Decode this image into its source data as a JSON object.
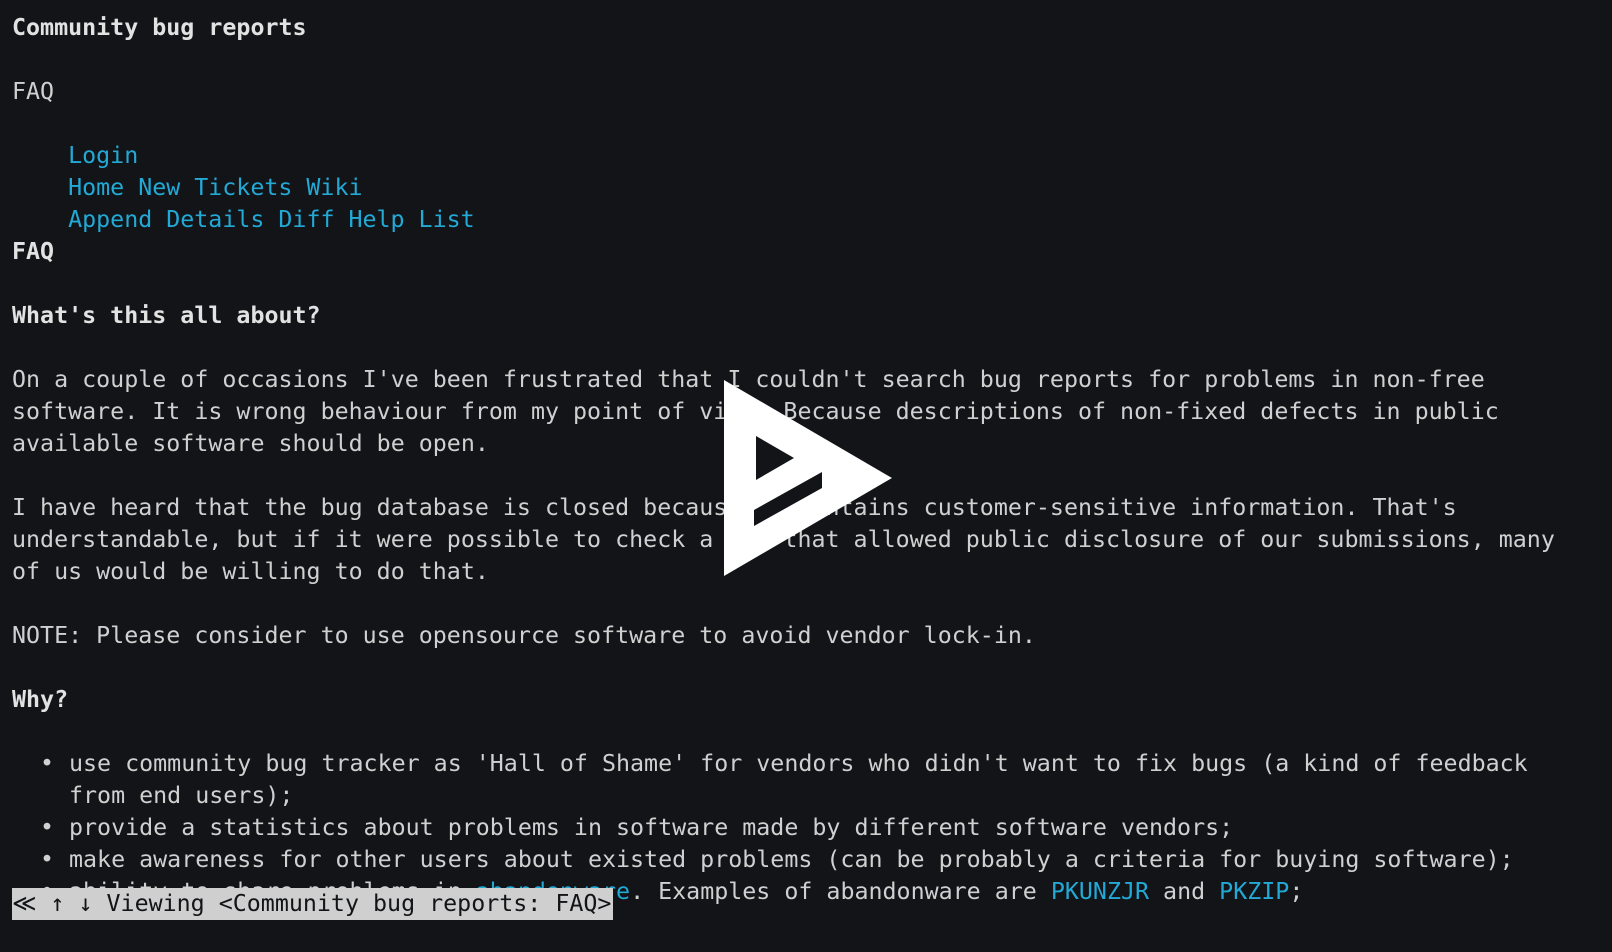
{
  "site": {
    "title": "Community bug reports"
  },
  "nav": {
    "current_page": "FAQ",
    "login": "Login",
    "primary": [
      "Home",
      "New",
      "Tickets",
      "Wiki"
    ],
    "secondary": [
      "Append",
      "Details",
      "Diff",
      "Help",
      "List"
    ]
  },
  "content": {
    "heading": "FAQ",
    "section1_heading": "What's this all about?",
    "para1": "On a couple of occasions I've been frustrated that I couldn't search bug reports for problems in non-free software. It is wrong behaviour from my point of view. Because descriptions of non-fixed defects in public available software should be open.",
    "para2": "I have heard that the bug database is closed because it contains customer-sensitive information. That's understandable, but if it were possible to check a box that allowed public disclosure of our submissions, many of us would be willing to do that.",
    "note": "NOTE: Please consider to use opensource software to avoid vendor lock-in.",
    "section2_heading": "Why?",
    "bullets": [
      "use community bug tracker as 'Hall of Shame' for vendors who didn't want to fix bugs (a kind of feedback from end users);",
      "provide a statistics about problems in software made by different software vendors;",
      "make awareness for other users about existed problems (can be probably a criteria for buying software);"
    ],
    "bullet4": {
      "prefix": "ability to share problems in ",
      "link1": "abandonware",
      "mid": ". Examples of abandonware are ",
      "link2": "PKUNZJR",
      "and": " and ",
      "link3": "PKZIP",
      "suffix": ";"
    }
  },
  "statusbar": {
    "text": "≪ ↑ ↓ Viewing <Community bug reports: FAQ>"
  },
  "overlay": {
    "icon": "play-icon"
  }
}
